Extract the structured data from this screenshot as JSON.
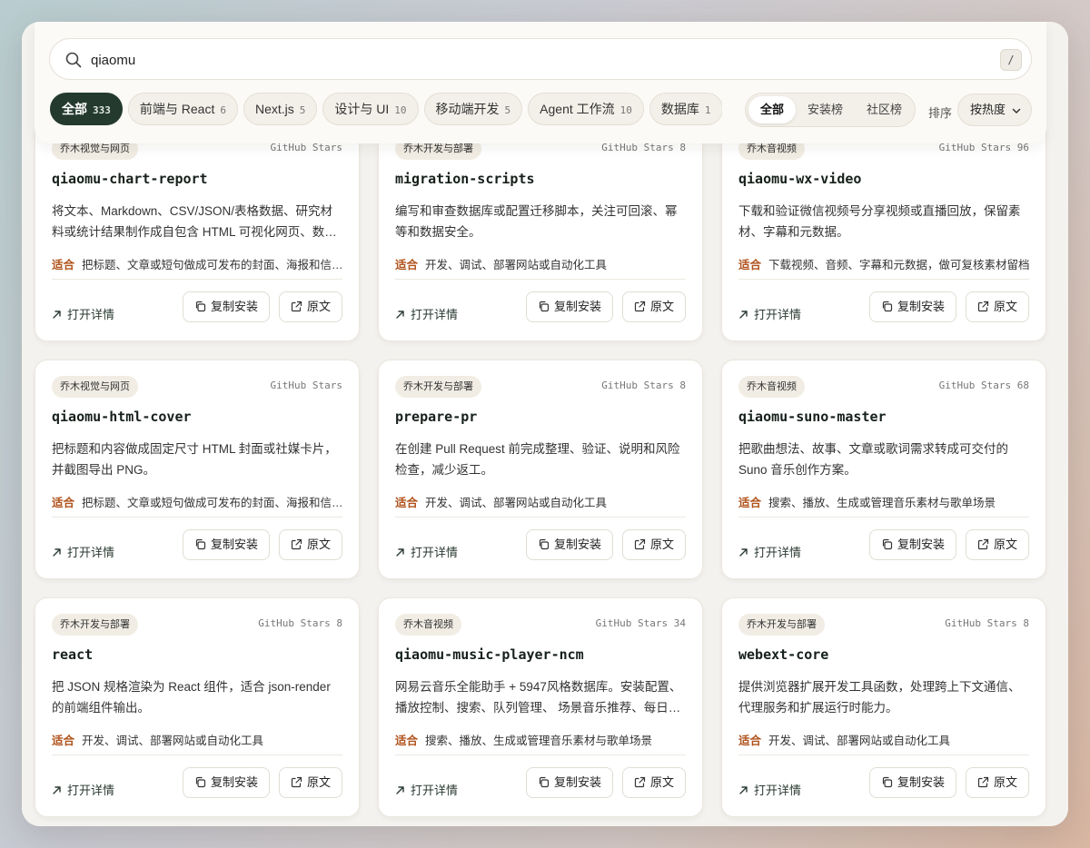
{
  "search": {
    "value": "qiaomu",
    "shortcut": "/"
  },
  "filters": [
    {
      "label": "全部",
      "count": "333",
      "active": true
    },
    {
      "label": "前端与 React",
      "count": "6"
    },
    {
      "label": "Next.js",
      "count": "5"
    },
    {
      "label": "设计与 UI",
      "count": "10"
    },
    {
      "label": "移动端开发",
      "count": "5"
    },
    {
      "label": "Agent 工作流",
      "count": "10"
    },
    {
      "label": "数据库",
      "count": "1"
    }
  ],
  "scope_tabs": [
    {
      "label": "全部",
      "active": true
    },
    {
      "label": "安装榜"
    },
    {
      "label": "社区榜"
    }
  ],
  "sort": {
    "label": "排序",
    "value": "按热度"
  },
  "card_ui": {
    "fit_key": "适合",
    "open": "打开详情",
    "copy": "复制安装",
    "source": "原文"
  },
  "cards": [
    {
      "tag": "乔木视觉与网页",
      "stars": "GitHub Stars",
      "title": "qiaomu-chart-report",
      "desc": "将文本、Markdown、CSV/JSON/表格数据、研究材料或统计结果制作成自包含 HTML 可视化网页、数…",
      "fit": "把标题、文章或短句做成可发布的封面、海报和信…"
    },
    {
      "tag": "乔木开发与部署",
      "stars": "GitHub Stars 8",
      "title": "migration-scripts",
      "desc": "编写和审查数据库或配置迁移脚本，关注可回滚、幂等和数据安全。",
      "fit": "开发、调试、部署网站或自动化工具"
    },
    {
      "tag": "乔木音视频",
      "stars": "GitHub Stars 96",
      "title": "qiaomu-wx-video",
      "desc": "下载和验证微信视频号分享视频或直播回放，保留素材、字幕和元数据。",
      "fit": "下载视频、音频、字幕和元数据，做可复核素材留档"
    },
    {
      "tag": "乔木视觉与网页",
      "stars": "GitHub Stars",
      "title": "qiaomu-html-cover",
      "desc": "把标题和内容做成固定尺寸 HTML 封面或社媒卡片，并截图导出 PNG。",
      "fit": "把标题、文章或短句做成可发布的封面、海报和信…"
    },
    {
      "tag": "乔木开发与部署",
      "stars": "GitHub Stars 8",
      "title": "prepare-pr",
      "desc": "在创建 Pull Request 前完成整理、验证、说明和风险检查，减少返工。",
      "fit": "开发、调试、部署网站或自动化工具"
    },
    {
      "tag": "乔木音视频",
      "stars": "GitHub Stars 68",
      "title": "qiaomu-suno-master",
      "desc": "把歌曲想法、故事、文章或歌词需求转成可交付的 Suno 音乐创作方案。",
      "fit": "搜索、播放、生成或管理音乐素材与歌单场景"
    },
    {
      "tag": "乔木开发与部署",
      "stars": "GitHub Stars 8",
      "title": "react",
      "desc": "把 JSON 规格渲染为 React 组件，适合 json-render 的前端组件输出。",
      "fit": "开发、调试、部署网站或自动化工具"
    },
    {
      "tag": "乔木音视频",
      "stars": "GitHub Stars 34",
      "title": "qiaomu-music-player-ncm",
      "desc": "网易云音乐全能助手 + 5947风格数据库。安装配置、播放控制、搜索、队列管理、 场景音乐推荐、每日…",
      "fit": "搜索、播放、生成或管理音乐素材与歌单场景"
    },
    {
      "tag": "乔木开发与部署",
      "stars": "GitHub Stars 8",
      "title": "webext-core",
      "desc": "提供浏览器扩展开发工具函数，处理跨上下文通信、代理服务和扩展运行时能力。",
      "fit": "开发、调试、部署网站或自动化工具"
    }
  ]
}
